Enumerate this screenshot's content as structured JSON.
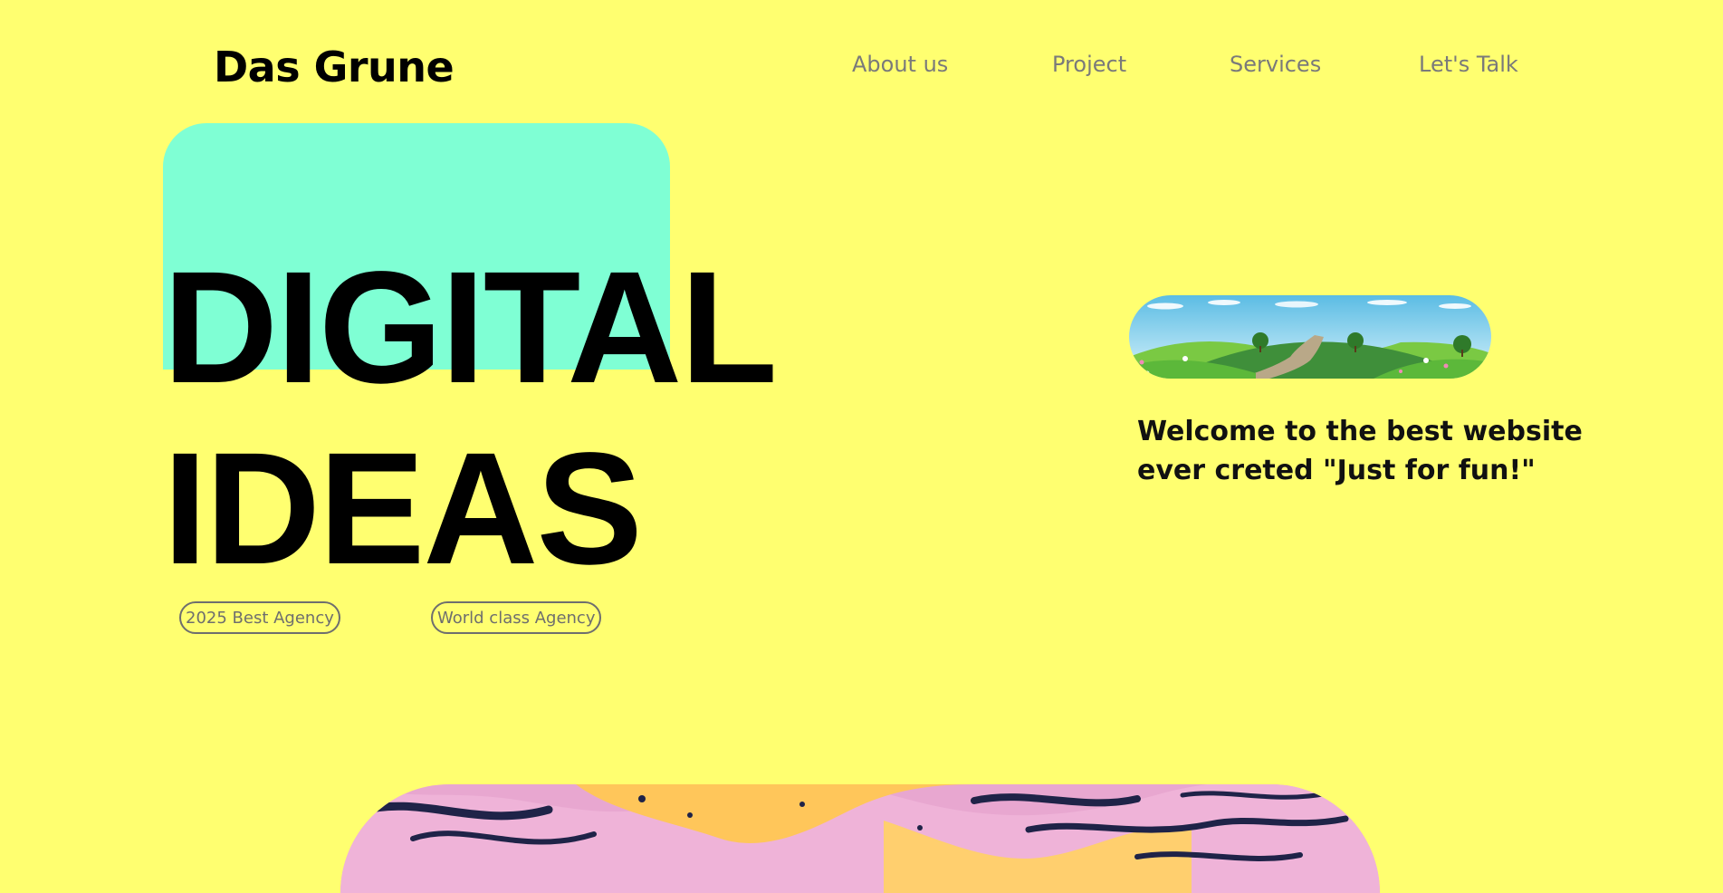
{
  "brand": {
    "name": "Das Grune"
  },
  "nav": {
    "items": [
      {
        "label": "About us"
      },
      {
        "label": "Project"
      },
      {
        "label": "Services"
      },
      {
        "label": "Let's Talk"
      }
    ]
  },
  "hero": {
    "headline_line1": "DIGITAL",
    "headline_line2": "IDEAS",
    "badges": [
      {
        "label": "2025 Best Agency"
      },
      {
        "label": "World class Agency"
      }
    ]
  },
  "intro": {
    "welcome_text": "Welcome to the best website ever creted \"Just for fun!\"",
    "landscape_image": "landscape-illustration"
  },
  "colors": {
    "background": "#ffff70",
    "accent_card": "#7fffd4",
    "text": "#000000",
    "nav_text": "#7a7a7a",
    "badge_border": "#6e6e6e"
  }
}
